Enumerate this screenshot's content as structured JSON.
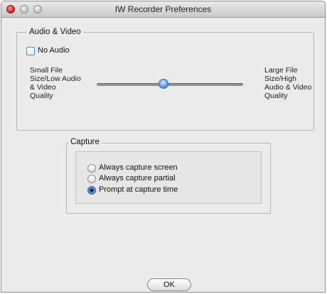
{
  "window": {
    "title": "IW Recorder Preferences"
  },
  "audio_video": {
    "legend": "Audio & Video",
    "no_audio": {
      "label": "No Audio",
      "checked": false
    },
    "slider": {
      "left_label": "Small File Size/Low Audio & Video Quality",
      "right_label": "Large File Size/High Audio & Video Quality",
      "value_fraction": 0.5
    }
  },
  "capture": {
    "legend": "Capture",
    "options": [
      {
        "label": "Always capture screen",
        "selected": false
      },
      {
        "label": "Always capture partial",
        "selected": false
      },
      {
        "label": "Prompt at capture time",
        "selected": true
      }
    ]
  },
  "buttons": {
    "ok": "OK"
  },
  "colors": {
    "accent": "#4f8fd4",
    "close": "#c4251a"
  }
}
